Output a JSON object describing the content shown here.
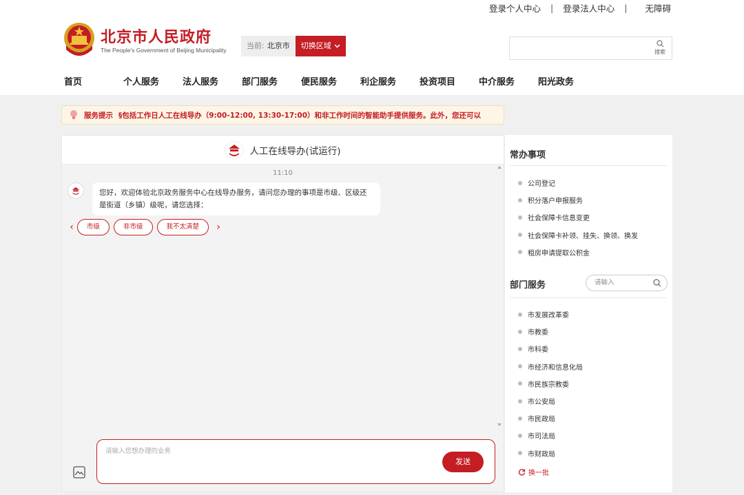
{
  "header": {
    "links": [
      "登录个人中心",
      "登录法人中心",
      "无障碍"
    ],
    "separator": "|",
    "title": "北京市人民政府",
    "subtitle": "The People's Government of Beijing Municipality",
    "region_label": "当前:",
    "region_value": "北京市",
    "region_switch": "切换区域",
    "search_label": "搜索",
    "search_placeholder": ""
  },
  "nav": [
    "首页",
    "个人服务",
    "法人服务",
    "部门服务",
    "便民服务",
    "利企服务",
    "投资项目",
    "中介服务",
    "阳光政务"
  ],
  "notice": {
    "label": "服务提示",
    "text": "§包括工作日人工在线导办（9:00-12:00, 13:30-17:00）和非工作时间的智能助手提供服务。此外，您还可以"
  },
  "chat": {
    "title": "人工在线导办(试运行)",
    "timestamp": "11:10",
    "message": "您好，欢迎体验北京政务服务中心在线导办服务，请问您办理的事项是市级、区级还是街道（乡镇）级呢，请您选择：",
    "options": [
      "市级",
      "非市级",
      "我不太清楚"
    ],
    "input_placeholder": "请输入您想办理的业务",
    "send_label": "发送"
  },
  "sidebar": {
    "common_title": "常办事项",
    "common_items": [
      "公司登记",
      "积分落户申报服务",
      "社会保障卡信息变更",
      "社会保障卡补领、挂失、换领、换发",
      "租房申请提取公积金"
    ],
    "dept_title": "部门服务",
    "dept_search_placeholder": "请输入",
    "dept_items": [
      "市发展改革委",
      "市教委",
      "市科委",
      "市经济和信息化局",
      "市民族宗教委",
      "市公安局",
      "市民政局",
      "市司法局",
      "市财政局"
    ],
    "refresh_label": "换一批"
  },
  "colors": {
    "brand": "#c41d24",
    "notice_bg": "#fdf6e6"
  }
}
